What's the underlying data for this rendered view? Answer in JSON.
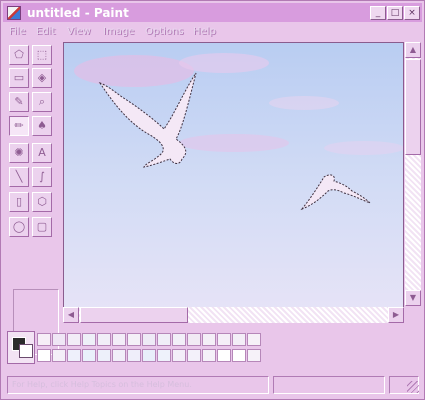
{
  "window": {
    "title": "untitled - Paint"
  },
  "title_buttons": {
    "minimize": "_",
    "maximize": "□",
    "close": "×"
  },
  "menu": [
    "File",
    "Edit",
    "View",
    "Image",
    "Options",
    "Help"
  ],
  "tools": [
    {
      "name": "free-form-select",
      "glyph": "⬠"
    },
    {
      "name": "select",
      "glyph": "⬚"
    },
    {
      "name": "eraser",
      "glyph": "▭"
    },
    {
      "name": "fill",
      "glyph": "◈"
    },
    {
      "name": "pick-color",
      "glyph": "✎"
    },
    {
      "name": "magnifier",
      "glyph": "⌕"
    },
    {
      "name": "pencil",
      "glyph": "✏"
    },
    {
      "name": "brush",
      "glyph": "♠"
    },
    {
      "name": "airbrush",
      "glyph": "✺"
    },
    {
      "name": "text",
      "glyph": "A"
    },
    {
      "name": "line",
      "glyph": "╲"
    },
    {
      "name": "curve",
      "glyph": "∫"
    },
    {
      "name": "rectangle",
      "glyph": "▯"
    },
    {
      "name": "polygon",
      "glyph": "⬡"
    },
    {
      "name": "ellipse",
      "glyph": "◯"
    },
    {
      "name": "rounded-rectangle",
      "glyph": "▢"
    }
  ],
  "selected_tool": "pencil",
  "scroll_arrows": {
    "up": "▲",
    "down": "▼",
    "left": "◀",
    "right": "▶"
  },
  "palette": {
    "foreground": "#2b2b2b",
    "background": "#ffffff",
    "colors": [
      "#f6eef7",
      "#efe6f5",
      "#f2ecf7",
      "#eef0f8",
      "#f1eef8",
      "#f3edf8",
      "#f4f0f8",
      "#eeeaf6",
      "#f0eef8",
      "#f2eff8",
      "#f1eaf4",
      "#f4eff7",
      "#f5eff8",
      "#f3eef7",
      "#f6f1f8",
      "#ffffff",
      "#f4eff8",
      "#eef0fb",
      "#e9f1fb",
      "#edf0fa",
      "#f1eef9",
      "#efeefa",
      "#e8eefa",
      "#eef2fb",
      "#f3eef9",
      "#f3f1fa",
      "#f5f1f9",
      "#ffffff",
      "#ffffff",
      "#f6f2f9"
    ]
  },
  "status": {
    "help_text": "For Help, click Help Topics on the Help Menu.",
    "coordinates": ""
  }
}
